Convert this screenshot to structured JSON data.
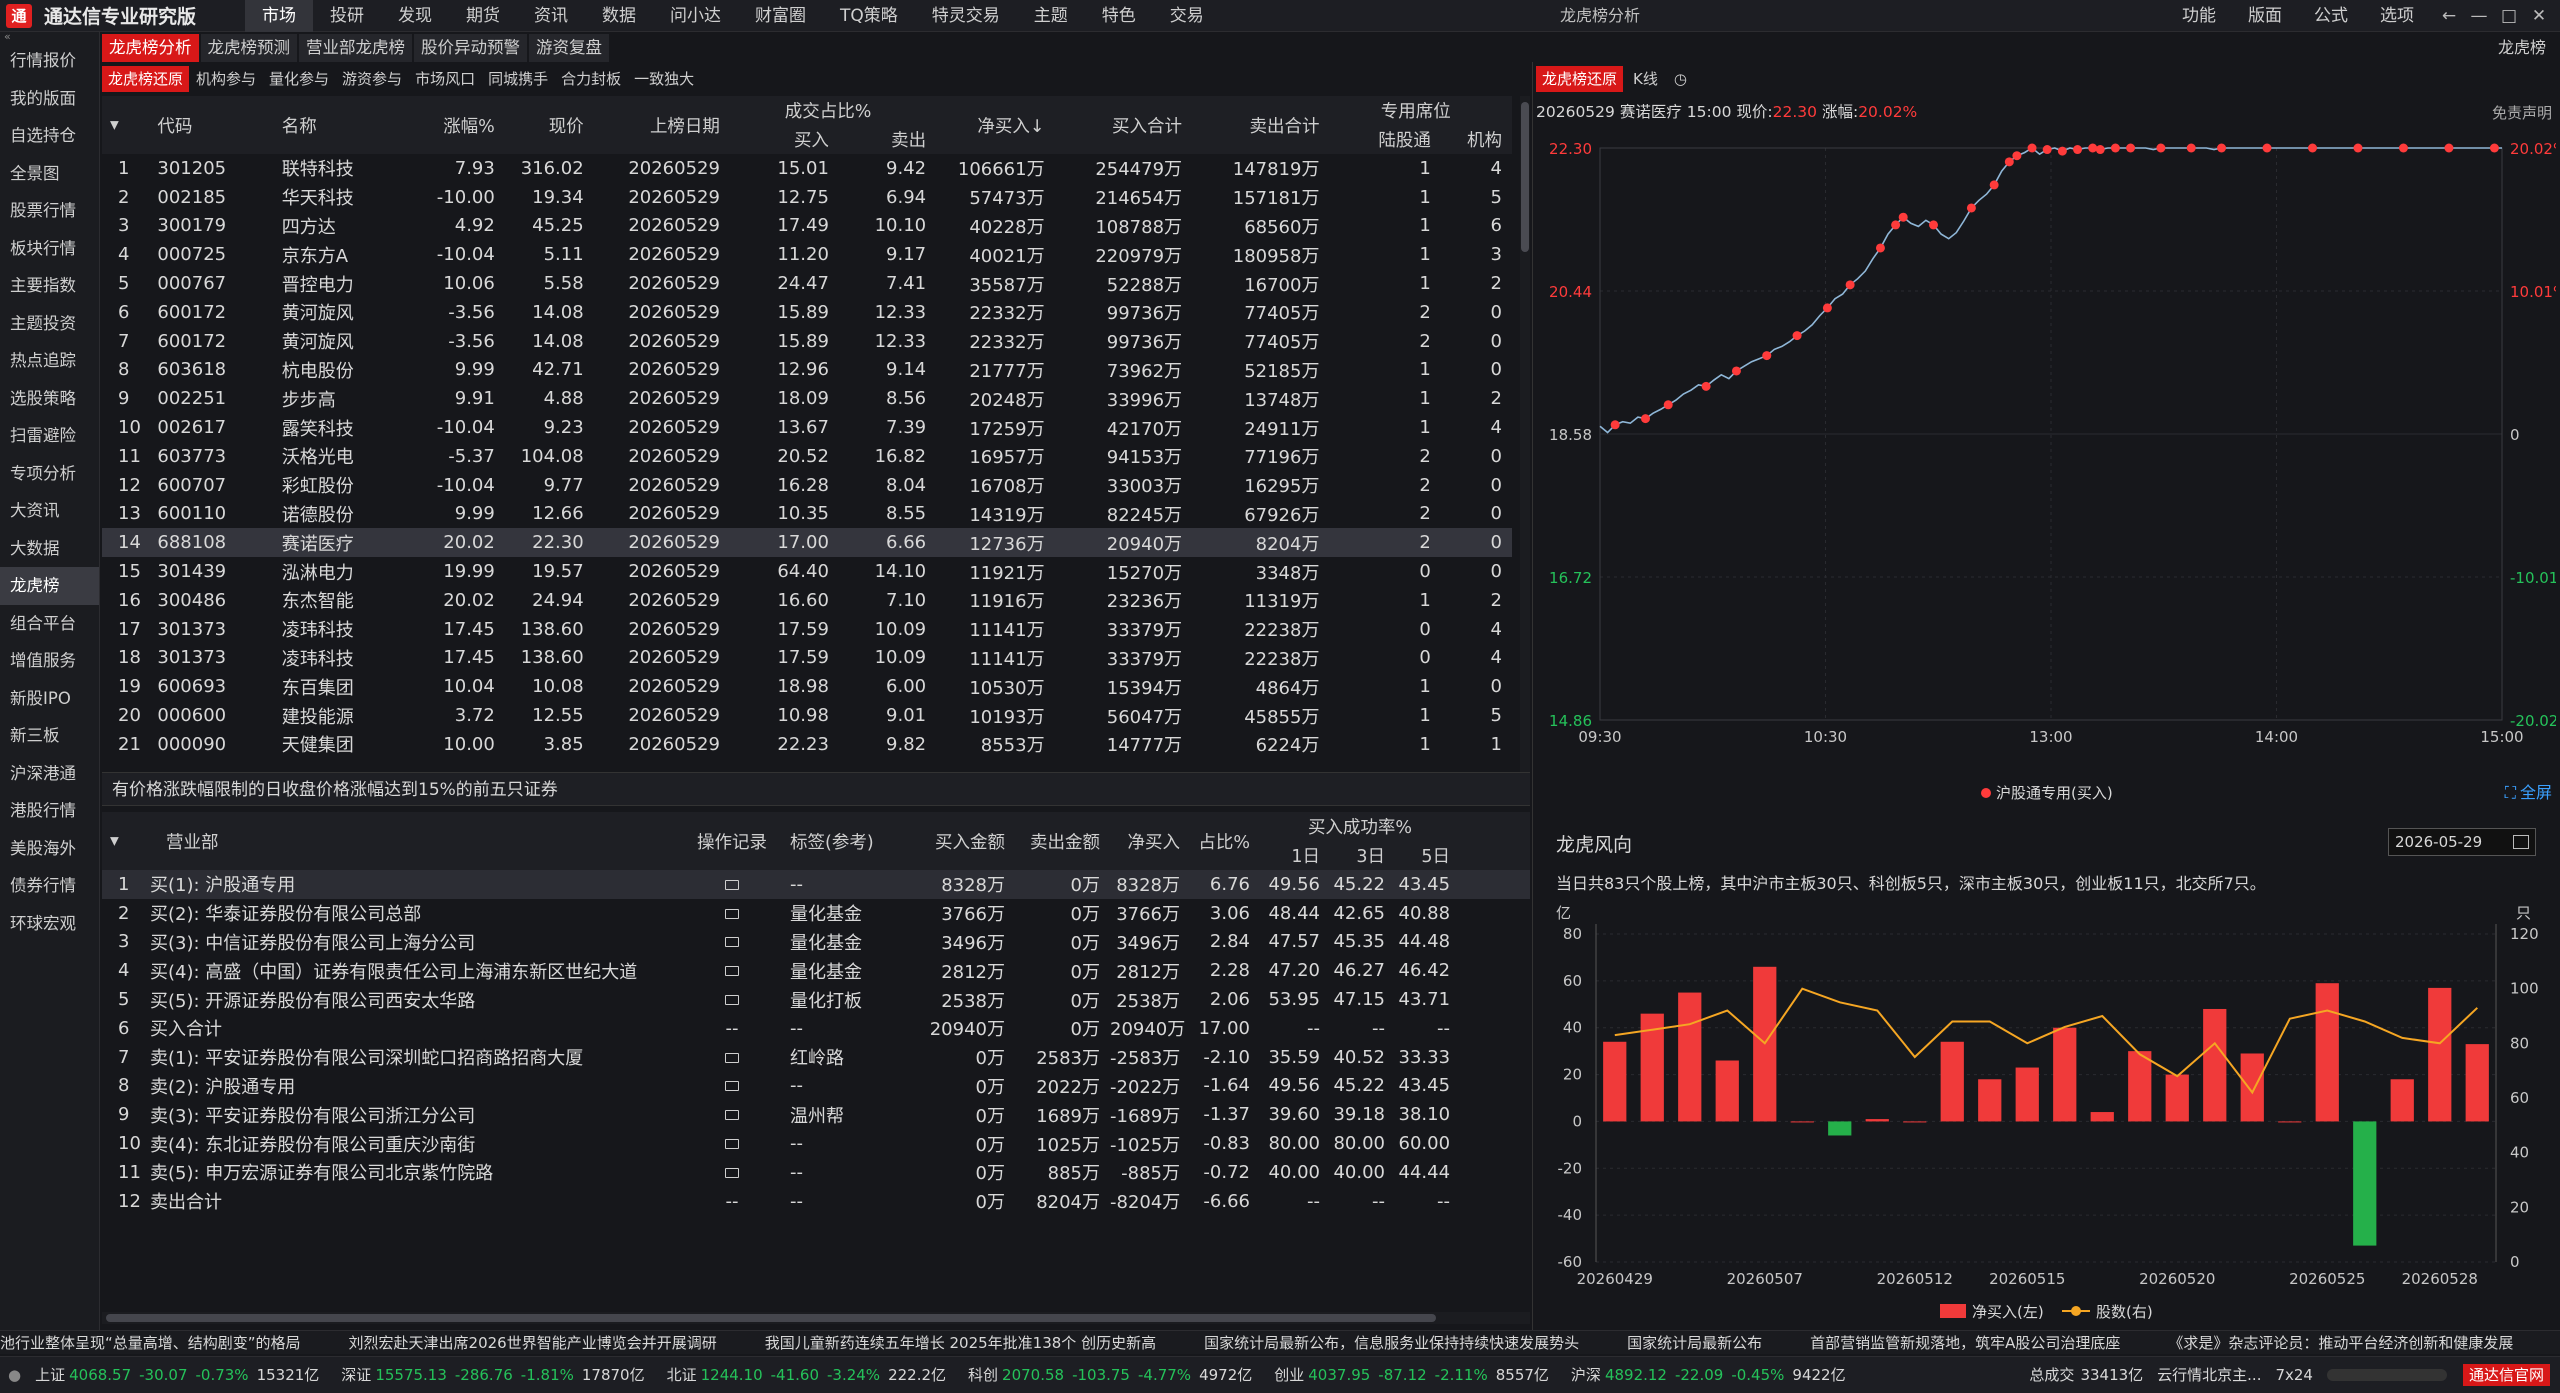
{
  "app": {
    "logo_char": "通",
    "title": "通达信专业研究版",
    "window_title": "龙虎榜分析"
  },
  "menu": [
    "市场",
    "投研",
    "发现",
    "期货",
    "资讯",
    "数据",
    "问小达",
    "财富圈",
    "TQ策略",
    "特灵交易",
    "主题",
    "特色",
    "交易"
  ],
  "menu_active": 0,
  "right_menu": [
    "功能",
    "版面",
    "公式",
    "选项"
  ],
  "window_controls": [
    "←",
    "—",
    "□",
    "✕"
  ],
  "sidebar": [
    "行情报价",
    "我的版面",
    "自选持仓",
    "全景图",
    "股票行情",
    "板块行情",
    "主要指数",
    "主题投资",
    "热点追踪",
    "选股策略",
    "扫雷避险",
    "专项分析",
    "大资讯",
    "大数据",
    "龙虎榜",
    "组合平台",
    "增值服务",
    "新股IPO",
    "新三板",
    "沪深港通",
    "港股行情",
    "美股海外",
    "债券行情",
    "环球宏观"
  ],
  "sidebar_active": 14,
  "tabs1": [
    "龙虎榜分析",
    "龙虎榜预测",
    "营业部龙虎榜",
    "股价异动预警",
    "游资复盘"
  ],
  "tabs2": [
    "龙虎榜还原",
    "机构参与",
    "量化参与",
    "游资参与",
    "市场风口",
    "同城携手",
    "合力封板",
    "一致独大"
  ],
  "top_right_title": "龙虎榜",
  "table1": {
    "headers": {
      "code": "代码",
      "name": "名称",
      "chg": "涨幅%",
      "price": "现价",
      "date": "上榜日期",
      "ratio": "成交占比%",
      "buy": "买入",
      "sell": "卖出",
      "net": "净买入↓",
      "buy_total": "买入合计",
      "sell_total": "卖出合计",
      "seat": "专用席位",
      "hk": "陆股通",
      "inst": "机构"
    },
    "rows": [
      [
        "1",
        "301205",
        "联特科技",
        "7.93",
        "316.02",
        "20260529",
        "15.01",
        "9.42",
        "106661万",
        "254479万",
        "147819万",
        "1",
        "4"
      ],
      [
        "2",
        "002185",
        "华天科技",
        "-10.00",
        "19.34",
        "20260529",
        "12.75",
        "6.94",
        "57473万",
        "214654万",
        "157181万",
        "1",
        "5"
      ],
      [
        "3",
        "300179",
        "四方达",
        "4.92",
        "45.25",
        "20260529",
        "17.49",
        "10.10",
        "40228万",
        "108788万",
        "68560万",
        "1",
        "6"
      ],
      [
        "4",
        "000725",
        "京东方A",
        "-10.04",
        "5.11",
        "20260529",
        "11.20",
        "9.17",
        "40021万",
        "220979万",
        "180958万",
        "1",
        "3"
      ],
      [
        "5",
        "000767",
        "晋控电力",
        "10.06",
        "5.58",
        "20260529",
        "24.47",
        "7.41",
        "35587万",
        "52288万",
        "16700万",
        "1",
        "2"
      ],
      [
        "6",
        "600172",
        "黄河旋风",
        "-3.56",
        "14.08",
        "20260529",
        "15.89",
        "12.33",
        "22332万",
        "99736万",
        "77405万",
        "2",
        "0"
      ],
      [
        "7",
        "600172",
        "黄河旋风",
        "-3.56",
        "14.08",
        "20260529",
        "15.89",
        "12.33",
        "22332万",
        "99736万",
        "77405万",
        "2",
        "0"
      ],
      [
        "8",
        "603618",
        "杭电股份",
        "9.99",
        "42.71",
        "20260529",
        "12.96",
        "9.14",
        "21777万",
        "73962万",
        "52185万",
        "1",
        "0"
      ],
      [
        "9",
        "002251",
        "步步高",
        "9.91",
        "4.88",
        "20260529",
        "18.09",
        "8.56",
        "20248万",
        "33996万",
        "13748万",
        "1",
        "2"
      ],
      [
        "10",
        "002617",
        "露笑科技",
        "-10.04",
        "9.23",
        "20260529",
        "13.67",
        "7.39",
        "17259万",
        "42170万",
        "24911万",
        "1",
        "4"
      ],
      [
        "11",
        "603773",
        "沃格光电",
        "-5.37",
        "104.08",
        "20260529",
        "20.52",
        "16.82",
        "16957万",
        "94153万",
        "77196万",
        "2",
        "0"
      ],
      [
        "12",
        "600707",
        "彩虹股份",
        "-10.04",
        "9.77",
        "20260529",
        "16.28",
        "8.04",
        "16708万",
        "33003万",
        "16295万",
        "2",
        "0"
      ],
      [
        "13",
        "600110",
        "诺德股份",
        "9.99",
        "12.66",
        "20260529",
        "10.35",
        "8.55",
        "14319万",
        "82245万",
        "67926万",
        "2",
        "0"
      ],
      [
        "14",
        "688108",
        "赛诺医疗",
        "20.02",
        "22.30",
        "20260529",
        "17.00",
        "6.66",
        "12736万",
        "20940万",
        "8204万",
        "2",
        "0"
      ],
      [
        "15",
        "301439",
        "泓淋电力",
        "19.99",
        "19.57",
        "20260529",
        "64.40",
        "14.10",
        "11921万",
        "15270万",
        "3348万",
        "0",
        "0"
      ],
      [
        "16",
        "300486",
        "东杰智能",
        "20.02",
        "24.94",
        "20260529",
        "16.60",
        "7.10",
        "11916万",
        "23236万",
        "11319万",
        "1",
        "2"
      ],
      [
        "17",
        "301373",
        "凌玮科技",
        "17.45",
        "138.60",
        "20260529",
        "17.59",
        "10.09",
        "11141万",
        "33379万",
        "22238万",
        "0",
        "4"
      ],
      [
        "18",
        "301373",
        "凌玮科技",
        "17.45",
        "138.60",
        "20260529",
        "17.59",
        "10.09",
        "11141万",
        "33379万",
        "22238万",
        "0",
        "4"
      ],
      [
        "19",
        "600693",
        "东百集团",
        "10.04",
        "10.08",
        "20260529",
        "18.98",
        "6.00",
        "10530万",
        "15394万",
        "4864万",
        "1",
        "0"
      ],
      [
        "20",
        "000600",
        "建投能源",
        "3.72",
        "12.55",
        "20260529",
        "10.98",
        "9.01",
        "10193万",
        "56047万",
        "45855万",
        "1",
        "5"
      ],
      [
        "21",
        "000090",
        "天健集团",
        "10.00",
        "3.85",
        "20260529",
        "22.23",
        "9.82",
        "8553万",
        "14777万",
        "6224万",
        "1",
        "1"
      ]
    ],
    "selected": 13
  },
  "note": "有价格涨跌幅限制的日收盘价格涨幅达到15%的前五只证券",
  "table2": {
    "headers": {
      "dept": "营业部",
      "log": "操作记录",
      "tag": "标签(参考)",
      "buy": "买入金额",
      "sell": "卖出金额",
      "net": "净买入",
      "pct": "占比%",
      "rate": "买入成功率%",
      "d1": "1日",
      "d3": "3日",
      "d5": "5日"
    },
    "rows": [
      [
        "1",
        "买(1): 沪股通专用",
        "1",
        "--",
        "8328万",
        "0万",
        "8328万",
        "6.76",
        "49.56",
        "45.22",
        "43.45"
      ],
      [
        "2",
        "买(2): 华泰证券股份有限公司总部",
        "1",
        "量化基金",
        "3766万",
        "0万",
        "3766万",
        "3.06",
        "48.44",
        "42.65",
        "40.88"
      ],
      [
        "3",
        "买(3): 中信证券股份有限公司上海分公司",
        "1",
        "量化基金",
        "3496万",
        "0万",
        "3496万",
        "2.84",
        "47.57",
        "45.35",
        "44.48"
      ],
      [
        "4",
        "买(4): 高盛（中国）证券有限责任公司上海浦东新区世纪大道",
        "1",
        "量化基金",
        "2812万",
        "0万",
        "2812万",
        "2.28",
        "47.20",
        "46.27",
        "46.42"
      ],
      [
        "5",
        "买(5): 开源证券股份有限公司西安太华路",
        "1",
        "量化打板",
        "2538万",
        "0万",
        "2538万",
        "2.06",
        "53.95",
        "47.15",
        "43.71"
      ],
      [
        "6",
        "买入合计",
        "0",
        "--",
        "20940万",
        "0万",
        "20940万",
        "17.00",
        "--",
        "--",
        "--"
      ],
      [
        "7",
        "卖(1): 平安证券股份有限公司深圳蛇口招商路招商大厦",
        "1",
        "红岭路",
        "0万",
        "2583万",
        "-2583万",
        "-2.10",
        "35.59",
        "40.52",
        "33.33"
      ],
      [
        "8",
        "卖(2): 沪股通专用",
        "1",
        "--",
        "0万",
        "2022万",
        "-2022万",
        "-1.64",
        "49.56",
        "45.22",
        "43.45"
      ],
      [
        "9",
        "卖(3): 平安证券股份有限公司浙江分公司",
        "1",
        "温州帮",
        "0万",
        "1689万",
        "-1689万",
        "-1.37",
        "39.60",
        "39.18",
        "38.10"
      ],
      [
        "10",
        "卖(4): 东北证券股份有限公司重庆沙南街",
        "1",
        "--",
        "0万",
        "1025万",
        "-1025万",
        "-0.83",
        "80.00",
        "80.00",
        "60.00"
      ],
      [
        "11",
        "卖(5): 申万宏源证券有限公司北京紫竹院路",
        "1",
        "--",
        "0万",
        "885万",
        "-885万",
        "-0.72",
        "40.00",
        "40.00",
        "44.44"
      ],
      [
        "12",
        "卖出合计",
        "0",
        "--",
        "0万",
        "8204万",
        "-8204万",
        "-6.66",
        "--",
        "--",
        "--"
      ]
    ],
    "dash": "--"
  },
  "right_tabs": [
    "龙虎榜还原",
    "K线",
    "◷"
  ],
  "minute_info": {
    "date": "20260529",
    "name": "赛诺医疗",
    "time": "15:00",
    "price_label": "现价:",
    "price": "22.30",
    "chg_label": "涨幅:",
    "chg": "20.02%"
  },
  "disclaimer": "免责声明",
  "colors": {
    "accent": "#d81818",
    "up": "#ff3b3b",
    "down": "#25c25a",
    "orange": "#f5a623",
    "price_line": "#8fb7d8"
  },
  "chart_data": [
    {
      "type": "line",
      "title": "",
      "x_ticks": [
        "09:30",
        "10:30",
        "13:00",
        "14:00",
        "15:00"
      ],
      "y_left_ticks": [
        "22.30",
        "20.44",
        "18.58",
        "16.72",
        "14.86"
      ],
      "y_right_ticks": [
        "20.02%",
        "10.01%",
        "0",
        "-10.01%",
        "-20.02%"
      ],
      "ylim": [
        14.86,
        22.3
      ],
      "series": [
        {
          "values": [
            18.68,
            18.6,
            18.7,
            18.74,
            18.72,
            18.8,
            18.78,
            18.85,
            18.9,
            18.96,
            19.02,
            19.1,
            19.15,
            19.22,
            19.2,
            19.28,
            19.35,
            19.3,
            19.4,
            19.46,
            19.52,
            19.56,
            19.6,
            19.68,
            19.72,
            19.78,
            19.86,
            19.92,
            20.0,
            20.12,
            20.22,
            20.34,
            20.4,
            20.52,
            20.6,
            20.7,
            20.86,
            21.0,
            21.18,
            21.3,
            21.4,
            21.32,
            21.28,
            21.36,
            21.3,
            21.18,
            21.12,
            21.2,
            21.35,
            21.52,
            21.62,
            21.7,
            21.82,
            22.0,
            22.12,
            22.2,
            22.24,
            22.3,
            22.22,
            22.28,
            22.3,
            22.26,
            22.3,
            22.28,
            22.3,
            22.3,
            22.28,
            22.3,
            22.3,
            22.3,
            22.3,
            22.3,
            22.3,
            22.28,
            22.3,
            22.3,
            22.3,
            22.3,
            22.3,
            22.3,
            22.3,
            22.28,
            22.3,
            22.3,
            22.3,
            22.3,
            22.3,
            22.3,
            22.3,
            22.3,
            22.3,
            22.3,
            22.3,
            22.3,
            22.3,
            22.3,
            22.3,
            22.3,
            22.3,
            22.3,
            22.3,
            22.3,
            22.3,
            22.3,
            22.3,
            22.3,
            22.3,
            22.3,
            22.3,
            22.3,
            22.3,
            22.3,
            22.3,
            22.3,
            22.3,
            22.3,
            22.3,
            22.3,
            22.3,
            22.3
          ]
        }
      ],
      "marker_indices": [
        2,
        6,
        9,
        14,
        18,
        22,
        26,
        30,
        33,
        37,
        39,
        40,
        44,
        49,
        52,
        54,
        55,
        57,
        59,
        61,
        63,
        65,
        66,
        68,
        70,
        74,
        78,
        82,
        88,
        94,
        100,
        106,
        112,
        118
      ],
      "legend": "沪股通专用(买入)",
      "fullscreen_label": "全屏"
    },
    {
      "type": "bar",
      "title": "龙虎风向",
      "date": "2026-05-29",
      "summary": "当日共83只个股上榜，其中沪市主板30只、科创板5只，深市主板30只，创业板11只，北交所7只。",
      "y_left_unit": "亿",
      "y_right_unit": "只",
      "y_left_ticks": [
        "80",
        "60",
        "40",
        "20",
        "0",
        "-20",
        "-40",
        "-60"
      ],
      "y_right_ticks": [
        "120",
        "100",
        "80",
        "60",
        "40",
        "20",
        "0"
      ],
      "ylim": [
        -60,
        80
      ],
      "y2lim": [
        0,
        120
      ],
      "x_ticks": [
        "20260429",
        "20260507",
        "20260512",
        "20260515",
        "20260520",
        "20260525",
        "20260528"
      ],
      "series": [
        {
          "name": "净买入(左)",
          "values": [
            34,
            46,
            55,
            26,
            66,
            0,
            -6,
            1,
            0,
            34,
            18,
            23,
            40,
            4,
            30,
            20,
            48,
            29,
            0,
            59,
            -53,
            18,
            57,
            33
          ]
        },
        {
          "name": "股数(右)",
          "values": [
            83,
            85,
            87,
            92,
            80,
            100,
            95,
            92,
            75,
            88,
            88,
            80,
            86,
            90,
            76,
            68,
            80,
            62,
            89,
            92,
            88,
            82,
            80,
            93
          ]
        }
      ]
    }
  ],
  "ticker": [
    "池行业整体呈现“总量高增、结构剧变”的格局",
    "刘烈宏赴天津出席2026世界智能产业博览会并开展调研",
    "我国儿童新药连续五年增长 2025年批准138个 创历史新高",
    "国家统计局最新公布，信息服务业保持持续快速发展势头",
    "国家统计局最新公布",
    "首部营销监管新规落地，筑牢A股公司治理底座",
    "《求是》杂志评论员：推动平台经济创新和健康发展"
  ],
  "status": [
    {
      "name": "上证",
      "val": "4068.57",
      "chg": "-30.07",
      "pct": "-0.73%",
      "amt": "15321亿"
    },
    {
      "name": "深证",
      "val": "15575.13",
      "chg": "-286.76",
      "pct": "-1.81%",
      "amt": "17870亿"
    },
    {
      "name": "北证",
      "val": "1244.10",
      "chg": "-41.60",
      "pct": "-3.24%",
      "amt": "222.2亿"
    },
    {
      "name": "科创",
      "val": "2070.58",
      "chg": "-103.75",
      "pct": "-4.77%",
      "amt": "4972亿"
    },
    {
      "name": "创业",
      "val": "4037.95",
      "chg": "-87.12",
      "pct": "-2.11%",
      "amt": "8557亿"
    },
    {
      "name": "沪深",
      "val": "4892.12",
      "chg": "-22.09",
      "pct": "-0.45%",
      "amt": "9422亿"
    }
  ],
  "status_right": {
    "total_label": "总成交",
    "total": "33413亿",
    "server": "云行情北京主...",
    "mode": "7x24",
    "brand": "通达信官网"
  }
}
